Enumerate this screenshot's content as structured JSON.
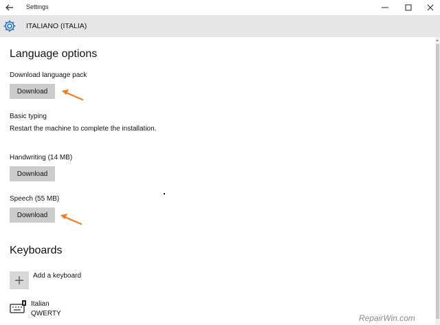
{
  "window": {
    "title": "Settings",
    "controls": [
      "minimize",
      "maximize",
      "close"
    ]
  },
  "header": {
    "title": "ITALIANO (ITALIA)",
    "icon": "gear-icon"
  },
  "language_options": {
    "heading": "Language options",
    "download_pack": {
      "label": "Download language pack",
      "button": "Download"
    },
    "basic_typing": {
      "label": "Basic typing",
      "status": "Restart the machine to complete the installation."
    },
    "handwriting": {
      "label": "Handwriting (14 MB)",
      "button": "Download"
    },
    "speech": {
      "label": "Speech (55 MB)",
      "button": "Download"
    }
  },
  "keyboards": {
    "heading": "Keyboards",
    "add_label": "Add a keyboard",
    "items": [
      {
        "name": "Italian",
        "layout": "QWERTY",
        "icon": "keyboard-icon"
      }
    ]
  },
  "annotation": {
    "arrow_color": "#f57c20"
  },
  "watermark": "RepairWin.com"
}
